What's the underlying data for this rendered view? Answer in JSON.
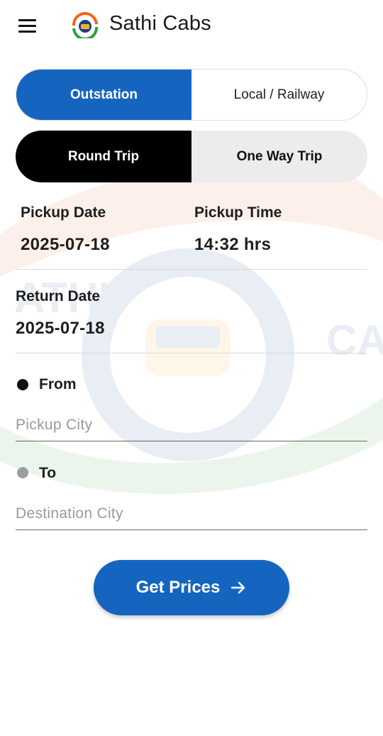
{
  "header": {
    "title": "Sathi Cabs",
    "menu_icon": "hamburger-menu-icon",
    "logo_icon": "sathi-cabs-logo"
  },
  "service_tabs": {
    "items": [
      {
        "label": "Outstation",
        "active": true
      },
      {
        "label": "Local / Railway",
        "active": false
      }
    ]
  },
  "trip_tabs": {
    "items": [
      {
        "label": "Round Trip",
        "active": true
      },
      {
        "label": "One Way Trip",
        "active": false
      }
    ]
  },
  "pickup": {
    "date_label": "Pickup Date",
    "date_value": "2025-07-18",
    "time_label": "Pickup Time",
    "time_value": "14:32 hrs"
  },
  "return": {
    "date_label": "Return Date",
    "date_value": "2025-07-18"
  },
  "from": {
    "label": "From",
    "placeholder": "Pickup City",
    "value": ""
  },
  "to": {
    "label": "To",
    "placeholder": "Destination City",
    "value": ""
  },
  "action": {
    "label": "Get Prices",
    "icon": "arrow-right-icon"
  },
  "colors": {
    "primary": "#1565c0",
    "trip_active": "#000000",
    "trip_inactive": "#ececec",
    "from_dot": "#111111",
    "to_dot": "#9e9e9e"
  }
}
